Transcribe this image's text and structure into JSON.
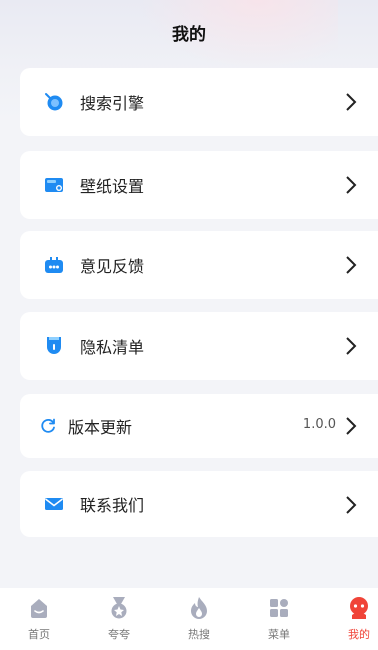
{
  "page": {
    "title": "我的"
  },
  "menu": [
    {
      "label": "搜索引擎",
      "icon": "search-engine-icon"
    },
    {
      "label": "壁纸设置",
      "icon": "wallpaper-icon"
    },
    {
      "label": "意见反馈",
      "icon": "feedback-icon"
    },
    {
      "label": "隐私清单",
      "icon": "privacy-icon"
    },
    {
      "label": "版本更新",
      "icon": "refresh-icon",
      "version": "1.0.0"
    },
    {
      "label": "联系我们",
      "icon": "mail-icon"
    }
  ],
  "tabbar": [
    {
      "label": "首页",
      "icon": "home-icon"
    },
    {
      "label": "夸夸",
      "icon": "medal-icon"
    },
    {
      "label": "热搜",
      "icon": "flame-icon"
    },
    {
      "label": "菜单",
      "icon": "grid-icon"
    },
    {
      "label": "我的",
      "icon": "profile-icon",
      "active": true
    }
  ],
  "colors": {
    "accent": "#1f8bf2",
    "active_tab": "#f04438",
    "inactive_icon": "#a9adbd"
  }
}
